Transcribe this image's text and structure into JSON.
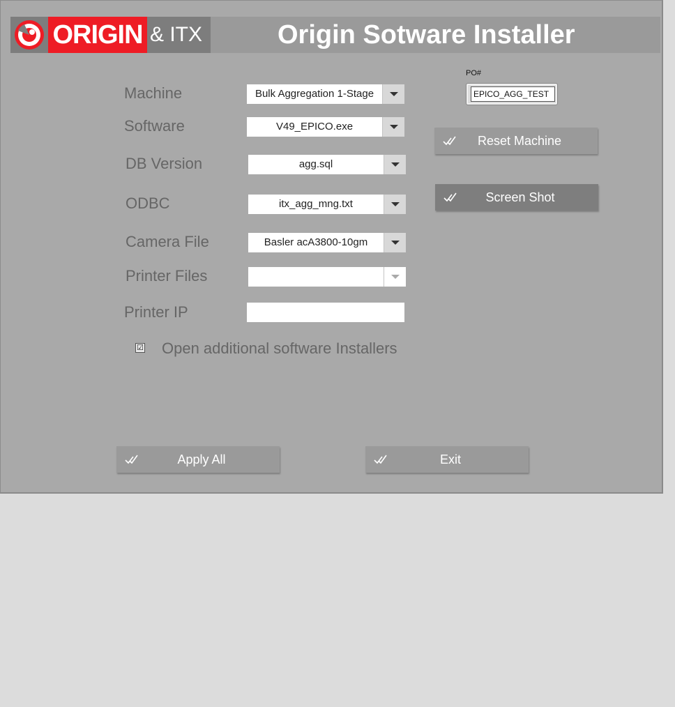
{
  "header": {
    "logo_text": "ORIGIN",
    "logo_suffix": "& ITX",
    "title": "Origin Sotware Installer"
  },
  "po": {
    "label": "PO#",
    "value": "EPICO_AGG_TEST"
  },
  "fields": {
    "machine": {
      "label": "Machine",
      "value": "Bulk Aggregation 1-Stage"
    },
    "software": {
      "label": "Software",
      "value": "V49_EPICO.exe"
    },
    "db_version": {
      "label": "DB Version",
      "value": "agg.sql"
    },
    "odbc": {
      "label": "ODBC",
      "value": "itx_agg_mng.txt"
    },
    "camera_file": {
      "label": "Camera File",
      "value": "Basler acA3800-10gm"
    },
    "printer_files": {
      "label": "Printer Files",
      "value": ""
    },
    "printer_ip": {
      "label": "Printer IP",
      "value": ""
    }
  },
  "checkbox": {
    "label": "Open additional software Installers",
    "checked": true,
    "mark": "☑"
  },
  "buttons": {
    "reset_machine": "Reset Machine",
    "screen_shot": "Screen Shot",
    "apply_all": "Apply All",
    "exit": "Exit"
  },
  "colors": {
    "panel": "#a9a9a9",
    "brand_red": "#ee1c25",
    "header": "#9a9a9a",
    "button": "#9a9a9a",
    "button_active": "#7e7e7e"
  }
}
